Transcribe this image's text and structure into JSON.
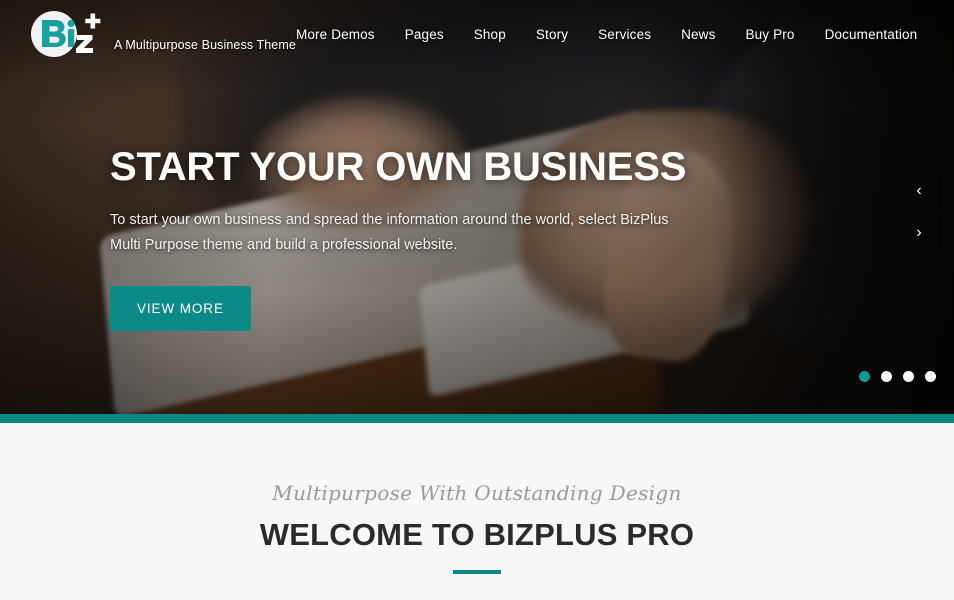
{
  "theme": {
    "accent_teal": "#0a8585",
    "button_teal": "#0c8a8a",
    "page_bg": "#f7f7f7",
    "heading_color": "#2b2b2b",
    "subtitle_color": "#9a9a9a"
  },
  "header": {
    "logo_text": "Biz+",
    "logo_letters": {
      "b": "B",
      "i": "i",
      "z": "z",
      "plus": "+"
    },
    "tagline": "A Multipurpose Business Theme",
    "search_icon": "search-icon",
    "nav": [
      {
        "label": "More Demos"
      },
      {
        "label": "Pages"
      },
      {
        "label": "Shop"
      },
      {
        "label": "Story"
      },
      {
        "label": "Services"
      },
      {
        "label": "News"
      },
      {
        "label": "Buy Pro"
      },
      {
        "label": "Documentation"
      }
    ]
  },
  "hero": {
    "title": "START YOUR OWN BUSINESS",
    "description": "To start your own business and spread the information around the world, select BizPlus Multi Purpose theme and build a professional website.",
    "cta_label": "VIEW MORE",
    "prev_icon": "‹",
    "next_icon": "›",
    "dots": [
      {
        "active": true
      },
      {
        "active": false
      },
      {
        "active": false
      },
      {
        "active": false
      }
    ]
  },
  "welcome": {
    "subtitle": "Multipurpose With Outstanding Design",
    "title": "WELCOME TO BIZPLUS PRO"
  }
}
